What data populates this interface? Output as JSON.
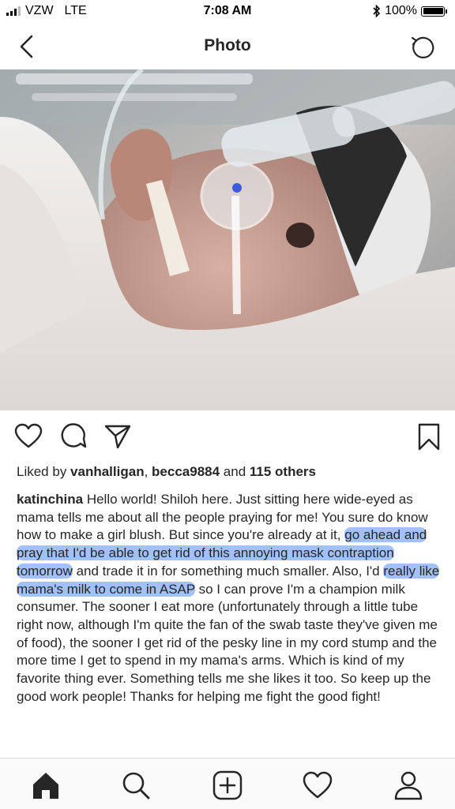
{
  "status_bar": {
    "carrier": "VZW",
    "network": "LTE",
    "time": "7:08 AM",
    "battery": "100%"
  },
  "nav": {
    "title": "Photo",
    "back_icon": "chevron-left-icon",
    "right_icon": "refresh-icon"
  },
  "photo": {
    "description_icon": "photo-image"
  },
  "actions": {
    "icons": [
      "heart-icon",
      "comment-icon",
      "share-icon",
      "bookmark-icon"
    ]
  },
  "likes": {
    "prefix": "Liked by ",
    "user1": "vanhalligan",
    "sep": ", ",
    "user2": "becca9884",
    "and": " and ",
    "others": "115 others"
  },
  "caption": {
    "username": "katinchina",
    "part1": " Hello world! Shiloh here. Just sitting here wide-eyed as mama tells me about all the people praying for me! You sure do know how to make a girl blush. But since you're already at it, ",
    "highlight1": "go ahead and pray that I'd be able to get rid of this annoying mask contraption tomorrow",
    "part2": " and trade it in for something much smaller. Also, I'd ",
    "highlight2": "really like mama's milk to come in ASAP",
    "part3": " so I can prove I'm a champion milk consumer. The sooner I eat more (unfortunately through a little tube right now, although I'm quite the fan of the swab taste they've given me of food), the sooner I get rid of the pesky line in my cord stump and the more time I get to spend in my mama's arms. Which is kind of my favorite thing ever. Something tells me she likes it too. So keep up the good work people! Thanks for helping me fight the good fight!"
  },
  "tabbar": {
    "icons": [
      "home-icon",
      "search-icon",
      "add-post-icon",
      "activity-heart-icon",
      "profile-icon"
    ]
  },
  "colors": {
    "highlight": "#568cf5",
    "text": "#262626",
    "tabbar_bg": "#fafafa"
  }
}
